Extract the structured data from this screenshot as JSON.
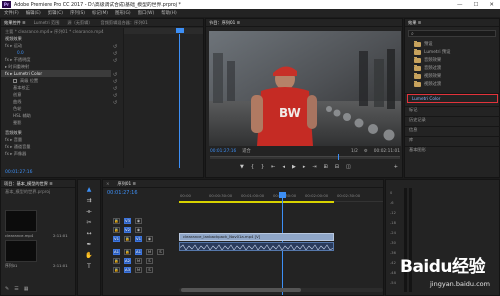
{
  "titlebar": {
    "app_icon": "Pr",
    "title": "Adobe Premiere Pro CC 2017 - D:\\高级调试合成\\基础_模型的世界.prproj *",
    "controls": [
      "—",
      "☐",
      "✕"
    ]
  },
  "menubar": {
    "items": [
      "文件(F)",
      "编辑(E)",
      "剪辑(C)",
      "序列(S)",
      "标记(M)",
      "图形(G)",
      "窗口(W)",
      "帮助(H)"
    ]
  },
  "effect_controls": {
    "tabs": [
      "效果控件 ≡",
      "Lumetri 范围",
      "源（无剪辑）",
      "音频剪辑混合器：序列01"
    ],
    "clip_path": "主要 * clearance.mp4 ▸ 序列01 * clearance.mp4",
    "section_video": "视频效果",
    "items": [
      "fx ▸ 运动",
      "fx ▸ 不透明度",
      "▸ 时间重映射",
      "fx ▸ Lumetri Color"
    ],
    "sub_value": "0.0",
    "checkbox_label": "高级 位置",
    "lumetri_subitems": [
      "基本校正",
      "创意",
      "曲线",
      "色轮",
      "HSL 辅助",
      "晕影"
    ],
    "section_audio": "音频效果",
    "audio_items": [
      "fx ▸ 音量",
      "fx ▸ 通道音量",
      "fx ▸ 声像器"
    ],
    "timecode": "00:01:27:16"
  },
  "program": {
    "tab": "节目：序列01 ≡",
    "jersey_text": "BW",
    "timecode_left": "00:01:27:16",
    "fit": "适合",
    "quality": "1/2",
    "timecode_right": "00:02:11:01"
  },
  "effects": {
    "tab": "效果 ≡",
    "search_placeholder": "",
    "folders": [
      "预设",
      "Lumetri 预设",
      "音频效果",
      "音频过渡",
      "视频效果",
      "视频过渡"
    ],
    "items": [
      "Lumetri Color",
      "标记",
      "历史记录",
      "信息",
      "库",
      "基本图形"
    ]
  },
  "project": {
    "tab": "项目：基本_模型的世界 ≡",
    "file": "基本_模型的世界.prproj",
    "clip1_name": "clearance.mp4",
    "clip1_duration": "2:11:01",
    "clip2_name": "序列01",
    "clip2_duration": "2:11:01"
  },
  "timeline": {
    "tab": "序列01 ≡",
    "timecode": "00:01:27:16",
    "ruler": [
      "00:00",
      "00:00:30:00",
      "00:01:00:00",
      "00:01:30:00",
      "00:02:00:00",
      "00:02:30:00"
    ],
    "video_tracks": [
      "V3",
      "V2",
      "V1"
    ],
    "audio_tracks": [
      "A1",
      "A2",
      "A3"
    ],
    "clip_label": "clearance_lanbackpack_Nov01a.mp4 [V]",
    "track_left_labels": [
      "V1",
      "A1"
    ]
  },
  "meter": {
    "scale": [
      "0",
      "-6",
      "-12",
      "-18",
      "-24",
      "-30",
      "-36",
      "-42",
      "-48",
      "-54"
    ]
  },
  "watermark": {
    "brand": "Baidu经验",
    "url": "jingyan.baidu.com"
  },
  "colors": {
    "accent": "#3d8ff5",
    "highlight_box": "#e2333b",
    "video_clip": "#8fa6c8",
    "work_area": "#d8d300"
  }
}
